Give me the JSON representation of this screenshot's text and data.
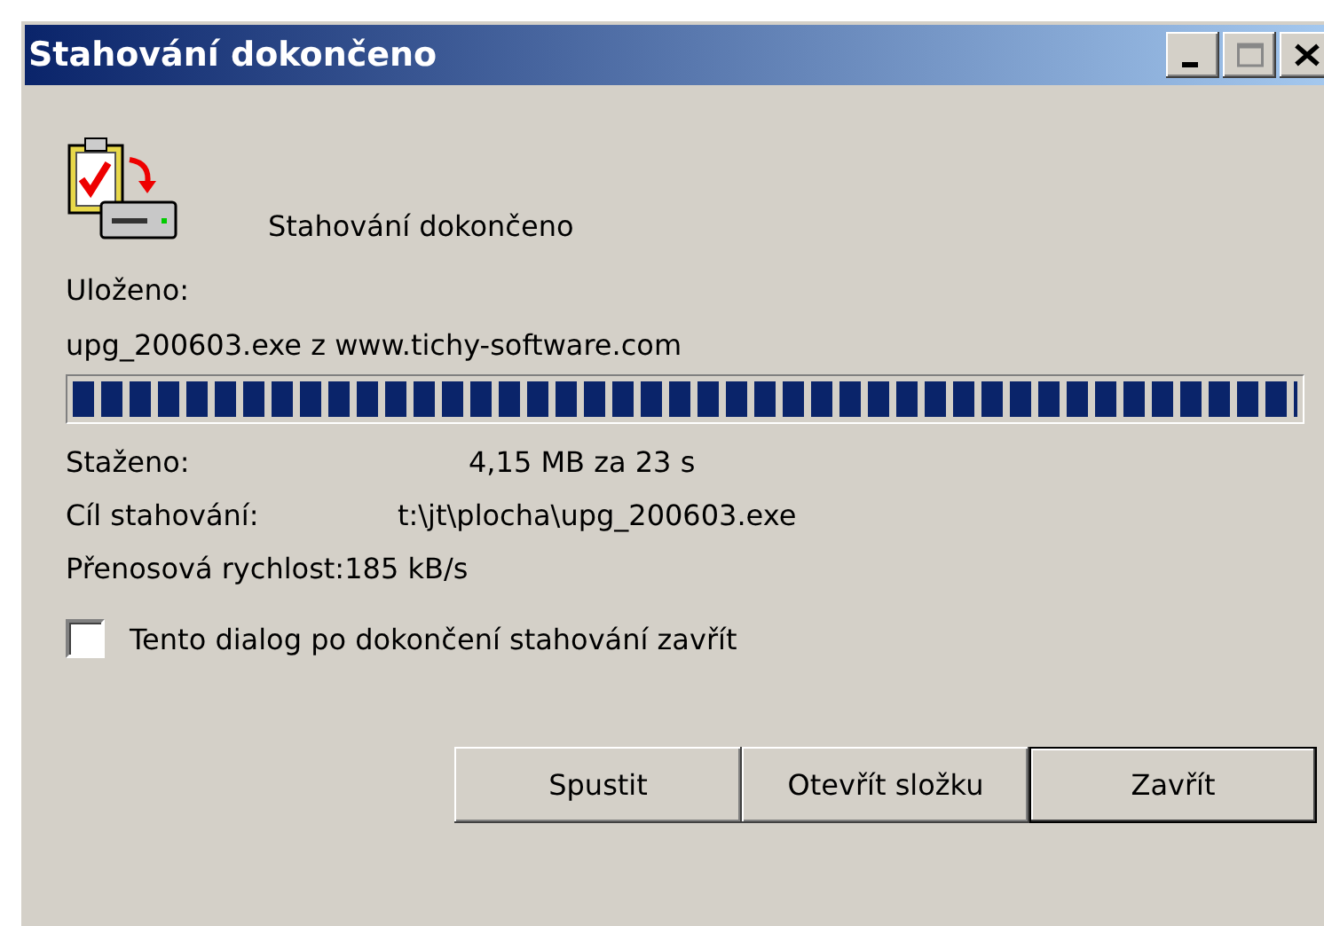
{
  "window": {
    "title": "Stahování dokončeno"
  },
  "heading": "Stahování dokončeno",
  "saved_label": "Uloženo:",
  "source": "upg_200603.exe z www.tichy-software.com",
  "progress": {
    "level": 1
  },
  "details": [
    {
      "label": "Staženo:",
      "value": "4,15 MB za 23 s",
      "kind": "wide"
    },
    {
      "label": "Cíl stahování:",
      "value": "t:\\jt\\plocha\\upg_200603.exe",
      "kind": "mid"
    },
    {
      "label": "Přenosová rychlost:",
      "value": "185 kB/s",
      "kind": "tight"
    }
  ],
  "close_option": {
    "label": "Tento dialog po dokončení stahování zavřít",
    "checked": false
  },
  "actions": [
    {
      "label": "Spustit",
      "default": false
    },
    {
      "label": "Otevřít složku",
      "default": false
    },
    {
      "label": "Zavřít",
      "default": true
    }
  ]
}
